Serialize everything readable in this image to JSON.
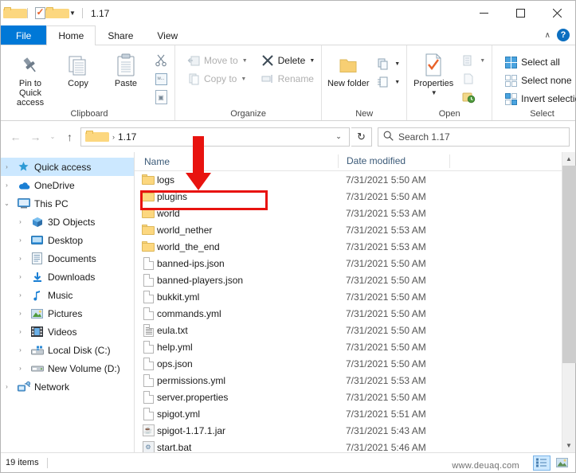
{
  "window": {
    "title": "1.17",
    "quick_access_toolbar": [
      {
        "name": "folder-properties-icon",
        "label": "Properties"
      },
      {
        "name": "new-folder-icon",
        "label": "New folder"
      },
      {
        "name": "customize-caret-icon",
        "label": "Customize Quick Access Toolbar"
      }
    ],
    "controls": {
      "minimize": "—",
      "maximize": "☐",
      "close": "✕"
    },
    "ribbon_collapse": "∧",
    "help": "?"
  },
  "tabs": [
    {
      "label": "File",
      "active": false,
      "kind": "file"
    },
    {
      "label": "Home",
      "active": true,
      "kind": "normal"
    },
    {
      "label": "Share",
      "active": false,
      "kind": "normal"
    },
    {
      "label": "View",
      "active": false,
      "kind": "normal"
    }
  ],
  "ribbon": {
    "groups": [
      {
        "label": "Clipboard",
        "big": [
          {
            "label": "Pin to Quick access",
            "icon": "pin-icon",
            "disabled": false
          },
          {
            "label": "Copy",
            "icon": "copy-icon",
            "disabled": false
          },
          {
            "label": "Paste",
            "icon": "paste-icon",
            "disabled": false
          }
        ],
        "small": [
          {
            "label": "Cut",
            "icon": "scissors-icon",
            "disabled": false
          },
          {
            "label": "Copy path",
            "icon": "copy-path-icon",
            "disabled": false
          },
          {
            "label": "Paste shortcut",
            "icon": "paste-shortcut-icon",
            "disabled": false
          }
        ]
      },
      {
        "label": "Organize",
        "small": [
          {
            "label": "Move to",
            "icon": "move-to-icon",
            "disabled": true,
            "caret": true
          },
          {
            "label": "Delete",
            "icon": "delete-x-icon",
            "disabled": false,
            "caret": true
          },
          {
            "label": "Copy to",
            "icon": "copy-to-icon",
            "disabled": true,
            "caret": true
          },
          {
            "label": "Rename",
            "icon": "rename-icon",
            "disabled": true,
            "caret": false
          }
        ]
      },
      {
        "label": "New",
        "big": [
          {
            "label": "New folder",
            "icon": "new-folder-icon",
            "disabled": false
          }
        ],
        "small": [
          {
            "label": "New item",
            "icon": "new-item-icon",
            "disabled": false,
            "caret": true
          },
          {
            "label": "Easy access",
            "icon": "easy-access-icon",
            "disabled": false,
            "caret": true
          }
        ]
      },
      {
        "label": "Open",
        "big": [
          {
            "label": "Properties",
            "icon": "properties-icon",
            "disabled": false
          }
        ],
        "small": [
          {
            "label": "Open",
            "icon": "open-icon",
            "disabled": true,
            "caret": true
          },
          {
            "label": "Edit",
            "icon": "edit-icon",
            "disabled": true,
            "caret": false
          },
          {
            "label": "History",
            "icon": "history-icon",
            "disabled": false,
            "caret": false
          }
        ]
      },
      {
        "label": "Select",
        "small": [
          {
            "label": "Select all",
            "icon": "select-all-icon",
            "disabled": false
          },
          {
            "label": "Select none",
            "icon": "select-none-icon",
            "disabled": false
          },
          {
            "label": "Invert selection",
            "icon": "invert-selection-icon",
            "disabled": false
          }
        ]
      }
    ]
  },
  "addressbar": {
    "back": "←",
    "forward": "→",
    "recent": "⌄",
    "up": "↑",
    "breadcrumb": [
      "1.17"
    ],
    "breadcrumb_sep": "›",
    "dropdown": "⌄",
    "refresh": "↻",
    "search_placeholder": "Search 1.17"
  },
  "sidebar": {
    "items": [
      {
        "label": "Quick access",
        "icon": "star-pin-icon",
        "chevron": "›",
        "indent": 0,
        "selected": true
      },
      {
        "label": "OneDrive",
        "icon": "onedrive-cloud-icon",
        "chevron": "›",
        "indent": 0,
        "selected": false
      },
      {
        "label": "This PC",
        "icon": "this-pc-icon",
        "chevron": "⌄",
        "indent": 0,
        "selected": false
      },
      {
        "label": "3D Objects",
        "icon": "3d-objects-icon",
        "chevron": "›",
        "indent": 1,
        "selected": false
      },
      {
        "label": "Desktop",
        "icon": "desktop-icon",
        "chevron": "›",
        "indent": 1,
        "selected": false
      },
      {
        "label": "Documents",
        "icon": "documents-icon",
        "chevron": "›",
        "indent": 1,
        "selected": false
      },
      {
        "label": "Downloads",
        "icon": "downloads-icon",
        "chevron": "›",
        "indent": 1,
        "selected": false
      },
      {
        "label": "Music",
        "icon": "music-icon",
        "chevron": "›",
        "indent": 1,
        "selected": false
      },
      {
        "label": "Pictures",
        "icon": "pictures-icon",
        "chevron": "›",
        "indent": 1,
        "selected": false
      },
      {
        "label": "Videos",
        "icon": "videos-icon",
        "chevron": "›",
        "indent": 1,
        "selected": false
      },
      {
        "label": "Local Disk (C:)",
        "icon": "local-disk-icon",
        "chevron": "›",
        "indent": 1,
        "selected": false
      },
      {
        "label": "New Volume (D:)",
        "icon": "drive-icon",
        "chevron": "›",
        "indent": 1,
        "selected": false
      },
      {
        "label": "Network",
        "icon": "network-icon",
        "chevron": "›",
        "indent": 0,
        "selected": false
      }
    ]
  },
  "filelist": {
    "columns": [
      {
        "label": "Name",
        "key": "name"
      },
      {
        "label": "Date modified",
        "key": "date"
      }
    ],
    "sort_indicator": "∧",
    "rows": [
      {
        "name": "logs",
        "date": "7/31/2021 5:50 AM",
        "icon": "folder-icon",
        "highlighted": false
      },
      {
        "name": "plugins",
        "date": "7/31/2021 5:50 AM",
        "icon": "folder-icon",
        "highlighted": true
      },
      {
        "name": "world",
        "date": "7/31/2021 5:53 AM",
        "icon": "folder-icon",
        "highlighted": false
      },
      {
        "name": "world_nether",
        "date": "7/31/2021 5:53 AM",
        "icon": "folder-icon",
        "highlighted": false
      },
      {
        "name": "world_the_end",
        "date": "7/31/2021 5:53 AM",
        "icon": "folder-icon",
        "highlighted": false
      },
      {
        "name": "banned-ips.json",
        "date": "7/31/2021 5:50 AM",
        "icon": "file-icon",
        "highlighted": false
      },
      {
        "name": "banned-players.json",
        "date": "7/31/2021 5:50 AM",
        "icon": "file-icon",
        "highlighted": false
      },
      {
        "name": "bukkit.yml",
        "date": "7/31/2021 5:50 AM",
        "icon": "file-icon",
        "highlighted": false
      },
      {
        "name": "commands.yml",
        "date": "7/31/2021 5:50 AM",
        "icon": "file-icon",
        "highlighted": false
      },
      {
        "name": "eula.txt",
        "date": "7/31/2021 5:50 AM",
        "icon": "text-file-icon",
        "highlighted": false
      },
      {
        "name": "help.yml",
        "date": "7/31/2021 5:50 AM",
        "icon": "file-icon",
        "highlighted": false
      },
      {
        "name": "ops.json",
        "date": "7/31/2021 5:50 AM",
        "icon": "file-icon",
        "highlighted": false
      },
      {
        "name": "permissions.yml",
        "date": "7/31/2021 5:53 AM",
        "icon": "file-icon",
        "highlighted": false
      },
      {
        "name": "server.properties",
        "date": "7/31/2021 5:50 AM",
        "icon": "file-icon",
        "highlighted": false
      },
      {
        "name": "spigot.yml",
        "date": "7/31/2021 5:51 AM",
        "icon": "file-icon",
        "highlighted": false
      },
      {
        "name": "spigot-1.17.1.jar",
        "date": "7/31/2021 5:43 AM",
        "icon": "jar-file-icon",
        "highlighted": false
      },
      {
        "name": "start.bat",
        "date": "7/31/2021 5:46 AM",
        "icon": "bat-file-icon",
        "highlighted": false
      }
    ]
  },
  "statusbar": {
    "item_count": "19 items",
    "watermark": "www.deuaq.com",
    "views": [
      {
        "name": "details-view-button",
        "active": true
      },
      {
        "name": "large-icons-view-button",
        "active": false
      }
    ]
  },
  "annotations": {
    "arrow_color": "#e8130f",
    "box_color": "#e8130f",
    "target": "plugins"
  }
}
